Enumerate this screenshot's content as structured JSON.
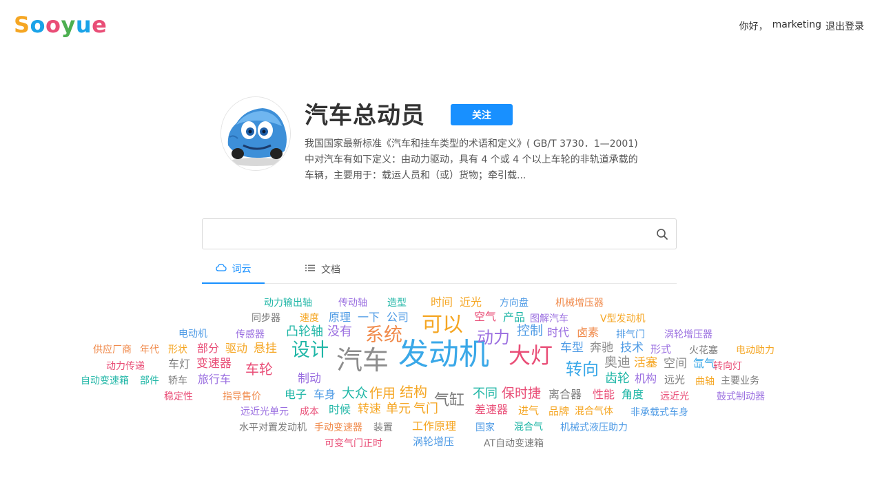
{
  "header": {
    "logo_letters": [
      {
        "ch": "S",
        "color": "#f5a623"
      },
      {
        "ch": "o",
        "color": "#1aa3e8"
      },
      {
        "ch": "o",
        "color": "#e94e77"
      },
      {
        "ch": "y",
        "color": "#4caf50"
      },
      {
        "ch": "u",
        "color": "#1aa3e8"
      },
      {
        "ch": "e",
        "color": "#e94e77"
      }
    ],
    "greeting": "你好，",
    "username": "marketing",
    "logout_label": "退出登录"
  },
  "profile": {
    "title": "汽车总动员",
    "follow_label": "关注",
    "description": "我国国家最新标准《汽车和挂车类型的术语和定义》( GB/T 3730．1—2001)中对汽车有如下定义：由动力驱动，具有 4 个或 4 个以上车轮的非轨道承载的车辆，主要用于：载运人员和（或）货物；牵引载..."
  },
  "search": {
    "placeholder": "",
    "value": ""
  },
  "tabs": [
    {
      "label": "词云",
      "icon": "cloud-icon",
      "active": true
    },
    {
      "label": "文档",
      "icon": "list-icon",
      "active": false
    }
  ],
  "colors": {
    "accent": "#1890ff",
    "palette": [
      "#1fb6a6",
      "#9a6ee0",
      "#3aa8e8",
      "#f5a623",
      "#e94e77",
      "#4f9be5",
      "#7a7a7a"
    ]
  },
  "wordcloud": [
    {
      "text": "发动机",
      "color": "#3aa8e8",
      "size": 44
    },
    {
      "text": "汽车",
      "color": "#8c8c8c",
      "size": 38
    },
    {
      "text": "大灯",
      "color": "#e94e77",
      "size": 32
    },
    {
      "text": "可以",
      "color": "#f5a623",
      "size": 30
    },
    {
      "text": "系统",
      "color": "#f08a4b",
      "size": 27
    },
    {
      "text": "设计",
      "color": "#1fb6a6",
      "size": 27
    },
    {
      "text": "动力",
      "color": "#9a6ee0",
      "size": 24
    },
    {
      "text": "转向",
      "color": "#3aa8e8",
      "size": 24
    },
    {
      "text": "气缸",
      "color": "#7a7a7a",
      "size": 22
    },
    {
      "text": "结构",
      "color": "#f5a623",
      "size": 20
    },
    {
      "text": "车轮",
      "color": "#e94e77",
      "size": 20
    },
    {
      "text": "控制",
      "color": "#4f9be5",
      "size": 19
    },
    {
      "text": "奥迪",
      "color": "#8c8c8c",
      "size": 19
    },
    {
      "text": "保时捷",
      "color": "#e94e77",
      "size": 19
    },
    {
      "text": "作用",
      "color": "#f5a623",
      "size": 19
    },
    {
      "text": "大众",
      "color": "#1fb6a6",
      "size": 19
    },
    {
      "text": "凸轮轴",
      "color": "#1fb6a6",
      "size": 18
    },
    {
      "text": "没有",
      "color": "#9a6ee0",
      "size": 18
    },
    {
      "text": "不同",
      "color": "#1fb6a6",
      "size": 18
    },
    {
      "text": "齿轮",
      "color": "#1fb6a6",
      "size": 18
    },
    {
      "text": "单元",
      "color": "#f5a623",
      "size": 18
    },
    {
      "text": "气门",
      "color": "#f5a623",
      "size": 18
    },
    {
      "text": "变速器",
      "color": "#e94e77",
      "size": 17
    },
    {
      "text": "活塞",
      "color": "#f5a623",
      "size": 17
    },
    {
      "text": "车型",
      "color": "#4f9be5",
      "size": 17
    },
    {
      "text": "奔驰",
      "color": "#8c8c8c",
      "size": 17
    },
    {
      "text": "技术",
      "color": "#4f9be5",
      "size": 17
    },
    {
      "text": "悬挂",
      "color": "#f5a623",
      "size": 17
    },
    {
      "text": "空间",
      "color": "#8c8c8c",
      "size": 17
    },
    {
      "text": "制动",
      "color": "#9a6ee0",
      "size": 17
    },
    {
      "text": "转速",
      "color": "#f5a623",
      "size": 17
    },
    {
      "text": "时代",
      "color": "#9a6ee0",
      "size": 16
    },
    {
      "text": "卤素",
      "color": "#f08a4b",
      "size": 16
    },
    {
      "text": "机构",
      "color": "#9a6ee0",
      "size": 16
    },
    {
      "text": "车身",
      "color": "#4f9be5",
      "size": 16
    },
    {
      "text": "电子",
      "color": "#1fb6a6",
      "size": 16
    },
    {
      "text": "原理",
      "color": "#4f9be5",
      "size": 16
    },
    {
      "text": "一下",
      "color": "#4f9be5",
      "size": 16
    },
    {
      "text": "公司",
      "color": "#4f9be5",
      "size": 16
    },
    {
      "text": "空气",
      "color": "#e94e77",
      "size": 16
    },
    {
      "text": "产品",
      "color": "#1fb6a6",
      "size": 16
    },
    {
      "text": "时间",
      "color": "#f5a623",
      "size": 16
    },
    {
      "text": "近光",
      "color": "#f5a623",
      "size": 16
    },
    {
      "text": "氙气",
      "color": "#3aa8e8",
      "size": 16
    },
    {
      "text": "部分",
      "color": "#e94e77",
      "size": 16
    },
    {
      "text": "驱动",
      "color": "#f5a623",
      "size": 16
    },
    {
      "text": "旅行车",
      "color": "#9a6ee0",
      "size": 16
    },
    {
      "text": "车灯",
      "color": "#7a7a7a",
      "size": 16
    },
    {
      "text": "时候",
      "color": "#1fb6a6",
      "size": 16
    },
    {
      "text": "差速器",
      "color": "#e94e77",
      "size": 16
    },
    {
      "text": "工作原理",
      "color": "#f5a623",
      "size": 16
    },
    {
      "text": "涡轮增压",
      "color": "#4f9be5",
      "size": 15
    },
    {
      "text": "进气",
      "color": "#f5a623",
      "size": 15
    },
    {
      "text": "品牌",
      "color": "#f5a623",
      "size": 15
    },
    {
      "text": "离合器",
      "color": "#7a7a7a",
      "size": 16
    },
    {
      "text": "性能",
      "color": "#e94e77",
      "size": 16
    },
    {
      "text": "角度",
      "color": "#1fb6a6",
      "size": 16
    },
    {
      "text": "形式",
      "color": "#9a6ee0",
      "size": 15
    },
    {
      "text": "远光",
      "color": "#7a7a7a",
      "size": 15
    },
    {
      "text": "混合气",
      "color": "#1fb6a6",
      "size": 14
    },
    {
      "text": "混合气体",
      "color": "#f5a623",
      "size": 14
    },
    {
      "text": "成本",
      "color": "#e94e77",
      "size": 14
    },
    {
      "text": "国家",
      "color": "#4f9be5",
      "size": 14
    },
    {
      "text": "装置",
      "color": "#7a7a7a",
      "size": 14
    },
    {
      "text": "速度",
      "color": "#f5a623",
      "size": 14
    },
    {
      "text": "造型",
      "color": "#1fb6a6",
      "size": 14
    },
    {
      "text": "方向盘",
      "color": "#4f9be5",
      "size": 14
    },
    {
      "text": "传动轴",
      "color": "#9a6ee0",
      "size": 14
    },
    {
      "text": "动力输出轴",
      "color": "#1fb6a6",
      "size": 14
    },
    {
      "text": "机械增压器",
      "color": "#f08a4b",
      "size": 14
    },
    {
      "text": "同步器",
      "color": "#7a7a7a",
      "size": 14
    },
    {
      "text": "图解汽车",
      "color": "#9a6ee0",
      "size": 14
    },
    {
      "text": "V型发动机",
      "color": "#f5a623",
      "size": 14
    },
    {
      "text": "电动机",
      "color": "#4f9be5",
      "size": 14
    },
    {
      "text": "传感器",
      "color": "#9a6ee0",
      "size": 14
    },
    {
      "text": "排气门",
      "color": "#4f9be5",
      "size": 14
    },
    {
      "text": "涡轮增压器",
      "color": "#9a6ee0",
      "size": 14
    },
    {
      "text": "供应厂商",
      "color": "#f08a4b",
      "size": 14
    },
    {
      "text": "年代",
      "color": "#f08a4b",
      "size": 14
    },
    {
      "text": "形状",
      "color": "#f5a623",
      "size": 14
    },
    {
      "text": "火花塞",
      "color": "#7a7a7a",
      "size": 14
    },
    {
      "text": "电动助力",
      "color": "#f5a623",
      "size": 14
    },
    {
      "text": "动力传递",
      "color": "#e94e77",
      "size": 14
    },
    {
      "text": "转向灯",
      "color": "#e94e77",
      "size": 14
    },
    {
      "text": "自动变速箱",
      "color": "#1fb6a6",
      "size": 14
    },
    {
      "text": "部件",
      "color": "#1fb6a6",
      "size": 14
    },
    {
      "text": "轿车",
      "color": "#7a7a7a",
      "size": 14
    },
    {
      "text": "曲轴",
      "color": "#f5a623",
      "size": 14
    },
    {
      "text": "主要业务",
      "color": "#7a7a7a",
      "size": 14
    },
    {
      "text": "稳定性",
      "color": "#e94e77",
      "size": 14
    },
    {
      "text": "指导售价",
      "color": "#f08a4b",
      "size": 14
    },
    {
      "text": "远近光",
      "color": "#e94e77",
      "size": 14
    },
    {
      "text": "鼓式制动器",
      "color": "#9a6ee0",
      "size": 14
    },
    {
      "text": "远近光单元",
      "color": "#9a6ee0",
      "size": 14
    },
    {
      "text": "非承载式车身",
      "color": "#4f9be5",
      "size": 14
    },
    {
      "text": "水平对置发动机",
      "color": "#7a7a7a",
      "size": 14
    },
    {
      "text": "手动变速器",
      "color": "#f08a4b",
      "size": 14
    },
    {
      "text": "机械式液压助力",
      "color": "#4f9be5",
      "size": 14
    },
    {
      "text": "可变气门正时",
      "color": "#e94e77",
      "size": 14
    },
    {
      "text": "AT自动变速箱",
      "color": "#7a7a7a",
      "size": 14
    }
  ]
}
